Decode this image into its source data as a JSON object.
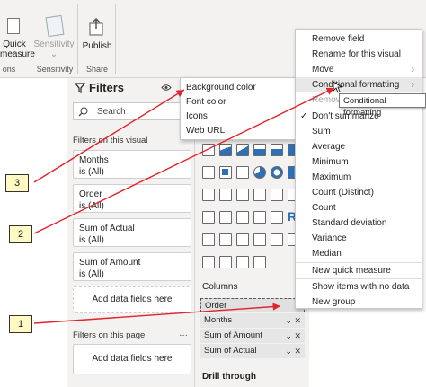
{
  "ribbon": {
    "quick_measure_line1": "Quick",
    "quick_measure_line2": "measure",
    "sensitivity_line1": "Sensitivity",
    "sensitivity_line2": "⌄",
    "publish_label": "Publish",
    "group_left": "ons",
    "group_sensitivity": "Sensitivity",
    "group_share": "Share"
  },
  "filters": {
    "title": "Filters",
    "search_placeholder": "Search",
    "section_visual": "Filters on this visual",
    "cards": [
      {
        "name": "Months",
        "value": "is (All)"
      },
      {
        "name": "Order",
        "value": "is (All)"
      },
      {
        "name": "Sum of Actual",
        "value": "is (All)"
      },
      {
        "name": "Sum of Amount",
        "value": "is (All)"
      }
    ],
    "add_fields": "Add data fields here",
    "section_page": "Filters on this page",
    "add_fields_page": "Add data fields here",
    "more": "…"
  },
  "viz": {
    "columns_label": "Columns",
    "wells": [
      "Order",
      "Months",
      "Sum of Amount",
      "Sum of Actual"
    ],
    "drill_through": "Drill through"
  },
  "submenu": {
    "items": [
      "Background color",
      "Font color",
      "Icons",
      "Web URL"
    ]
  },
  "context_menu": {
    "items": [
      "Remove field",
      "Rename for this visual",
      "Move",
      "Conditional formatting",
      "Remove",
      "Don't summarize",
      "Sum",
      "Average",
      "Minimum",
      "Maximum",
      "Count (Distinct)",
      "Count",
      "Standard deviation",
      "Variance",
      "Median",
      "New quick measure",
      "Show items with no data",
      "New group"
    ]
  },
  "tooltip": "Conditional formatting",
  "callouts": [
    "1",
    "2",
    "3"
  ],
  "colors": {
    "arrow": "#e0242a",
    "callout_bg": "#fff9c4",
    "accent": "#2f6fb5"
  }
}
